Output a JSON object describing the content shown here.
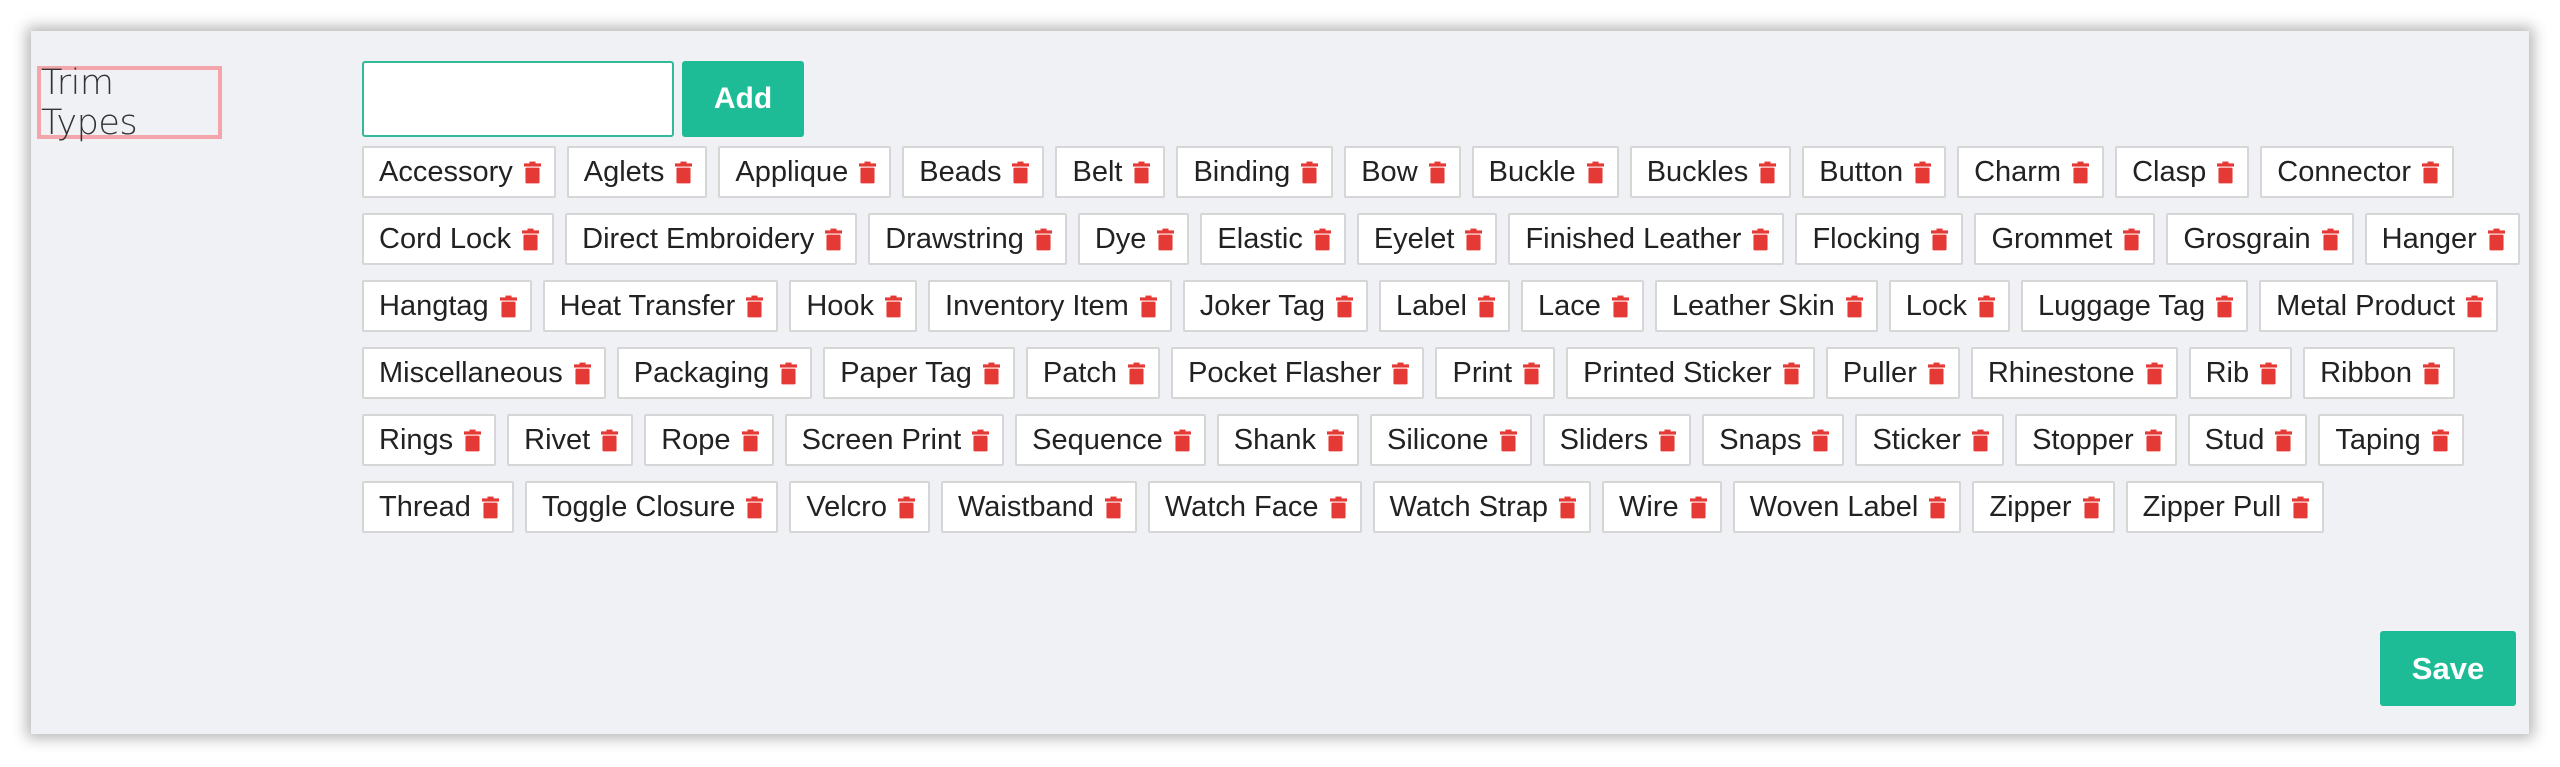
{
  "form": {
    "field_label": "Trim Types",
    "input": {
      "value": "",
      "placeholder": ""
    },
    "add_label": "Add",
    "save_label": "Save"
  },
  "icons": {
    "delete_icon": "trash-icon",
    "delete_color": "#e53935"
  },
  "colors": {
    "accent": "#1ebc96",
    "highlight_border": "#f2a5ab"
  },
  "tags": [
    "Accessory",
    "Aglets",
    "Applique",
    "Beads",
    "Belt",
    "Binding",
    "Bow",
    "Buckle",
    "Buckles",
    "Button",
    "Charm",
    "Clasp",
    "Connector",
    "Cord Lock",
    "Direct Embroidery",
    "Drawstring",
    "Dye",
    "Elastic",
    "Eyelet",
    "Finished Leather",
    "Flocking",
    "Grommet",
    "Grosgrain",
    "Hanger",
    "Hangtag",
    "Heat Transfer",
    "Hook",
    "Inventory Item",
    "Joker Tag",
    "Label",
    "Lace",
    "Leather Skin",
    "Lock",
    "Luggage Tag",
    "Metal Product",
    "Miscellaneous",
    "Packaging",
    "Paper Tag",
    "Patch",
    "Pocket Flasher",
    "Print",
    "Printed Sticker",
    "Puller",
    "Rhinestone",
    "Rib",
    "Ribbon",
    "Rings",
    "Rivet",
    "Rope",
    "Screen Print",
    "Sequence",
    "Shank",
    "Silicone",
    "Sliders",
    "Snaps",
    "Sticker",
    "Stopper",
    "Stud",
    "Taping",
    "Thread",
    "Toggle Closure",
    "Velcro",
    "Waistband",
    "Watch Face",
    "Watch Strap",
    "Wire",
    "Woven Label",
    "Zipper",
    "Zipper Pull"
  ]
}
